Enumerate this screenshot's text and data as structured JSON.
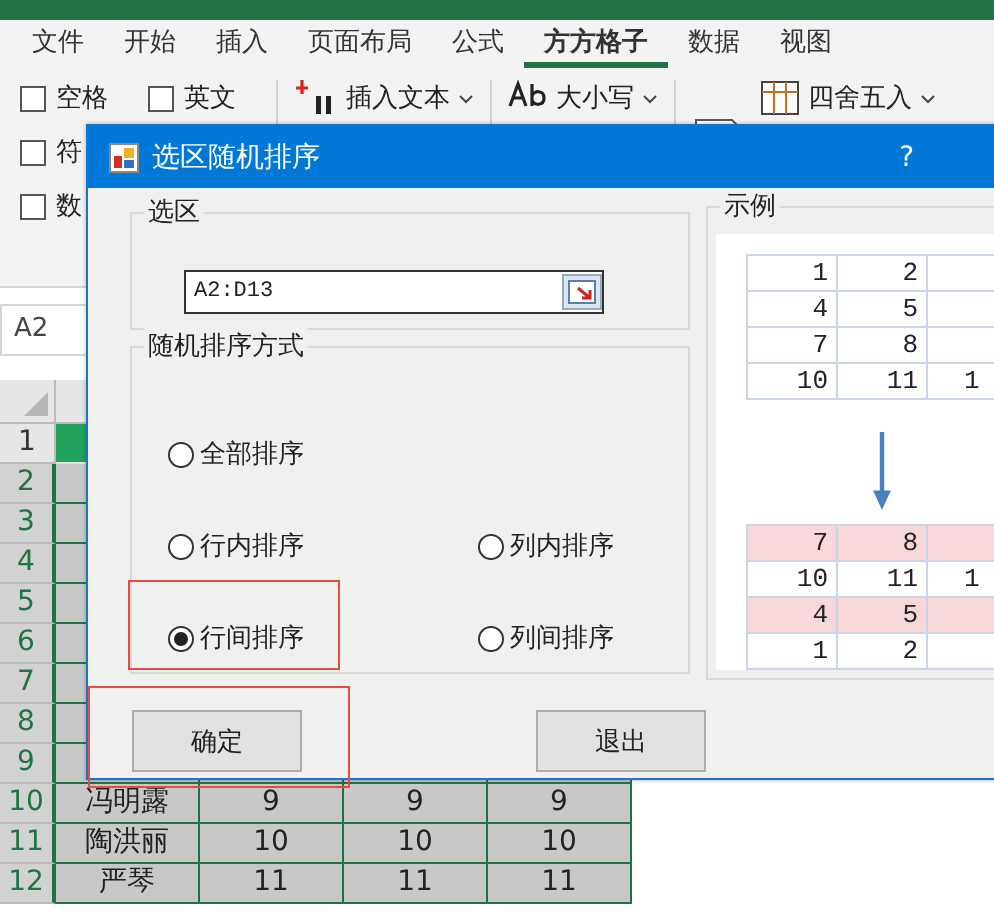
{
  "ribbon_tabs": [
    {
      "label": "文件",
      "selected": false
    },
    {
      "label": "开始",
      "selected": false
    },
    {
      "label": "插入",
      "selected": false
    },
    {
      "label": "页面布局",
      "selected": false
    },
    {
      "label": "公式",
      "selected": false
    },
    {
      "label": "方方格子",
      "selected": true
    },
    {
      "label": "数据",
      "selected": false
    },
    {
      "label": "视图",
      "selected": false
    }
  ],
  "ribbon": {
    "checkboxes": [
      {
        "label": "空格",
        "checked": false
      },
      {
        "label": "英文",
        "checked": false
      },
      {
        "label": "符",
        "checked": false
      },
      {
        "label": "数",
        "checked": false
      }
    ],
    "tools": [
      {
        "label": "插入文本",
        "kind": "insert"
      },
      {
        "label": "大小写",
        "kind": "case"
      },
      {
        "label": "四舍五入",
        "kind": "round"
      }
    ]
  },
  "name_box": "A2",
  "sheet": {
    "rows": [
      {
        "number": "1"
      },
      {
        "number": "2"
      },
      {
        "number": "3"
      },
      {
        "number": "4"
      },
      {
        "number": "5"
      },
      {
        "number": "6"
      },
      {
        "number": "7"
      },
      {
        "number": "8"
      },
      {
        "number": "9"
      },
      {
        "number": "10",
        "cells": [
          "冯明露",
          "9",
          "9",
          "9"
        ]
      },
      {
        "number": "11",
        "cells": [
          "陶洪丽",
          "10",
          "10",
          "10"
        ]
      },
      {
        "number": "12",
        "cells": [
          "严琴",
          "11",
          "11",
          "11"
        ]
      }
    ]
  },
  "dialog": {
    "title": "选区随机排序",
    "help": "?",
    "selection_group": {
      "title": "选区",
      "value": "A2:D13"
    },
    "mode_group": {
      "title": "随机排序方式",
      "options": [
        {
          "label": "全部排序",
          "selected": false,
          "highlighted": false
        },
        {
          "label": "行内排序",
          "selected": false,
          "highlighted": false
        },
        {
          "label": "列内排序",
          "selected": false,
          "highlighted": false
        },
        {
          "label": "行间排序",
          "selected": true,
          "highlighted": true
        },
        {
          "label": "列间排序",
          "selected": false,
          "highlighted": false
        }
      ]
    },
    "buttons": [
      {
        "label": "确定",
        "highlighted": true
      },
      {
        "label": "退出",
        "highlighted": false
      }
    ],
    "example": {
      "title": "示例",
      "before": [
        {
          "cells": [
            "1",
            "2"
          ],
          "highlighted": false
        },
        {
          "cells": [
            "4",
            "5"
          ],
          "highlighted": false
        },
        {
          "cells": [
            "7",
            "8"
          ],
          "highlighted": false
        },
        {
          "cells": [
            "10",
            "11",
            "1"
          ],
          "highlighted": false
        }
      ],
      "after": [
        {
          "cells": [
            "7",
            "8"
          ],
          "highlighted": true
        },
        {
          "cells": [
            "10",
            "11",
            "1"
          ],
          "highlighted": false
        },
        {
          "cells": [
            "4",
            "5"
          ],
          "highlighted": true
        },
        {
          "cells": [
            "1",
            "2"
          ],
          "highlighted": false
        }
      ]
    }
  }
}
